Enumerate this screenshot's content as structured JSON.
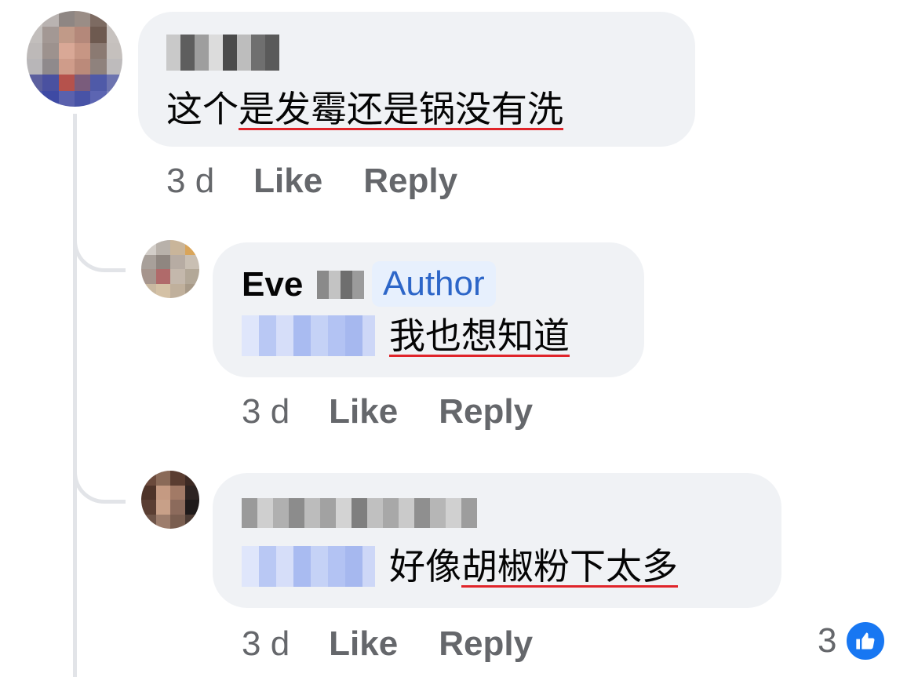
{
  "comments": [
    {
      "text_plain": "这个",
      "text_flagged": "是发霉还是锅没有洗",
      "time": "3 d",
      "like_label": "Like",
      "reply_label": "Reply"
    }
  ],
  "replies": [
    {
      "author_name": "Eve",
      "badge": "Author",
      "text_flagged": "我也想知道",
      "time": "3 d",
      "like_label": "Like",
      "reply_label": "Reply"
    },
    {
      "text_plain": "好像",
      "text_flagged": "胡椒粉下太多",
      "time": "3 d",
      "like_label": "Like",
      "reply_label": "Reply",
      "reaction_count": "3"
    }
  ],
  "icons": {
    "reaction": "thumbs-up-icon"
  },
  "colors": {
    "bubble": "#f0f2f5",
    "badge_bg": "#e7f0fd",
    "badge_text": "#2d66c8",
    "meta_text": "#65676b",
    "like_blue": "#1877f2",
    "spell_underline": "#e0242a"
  }
}
